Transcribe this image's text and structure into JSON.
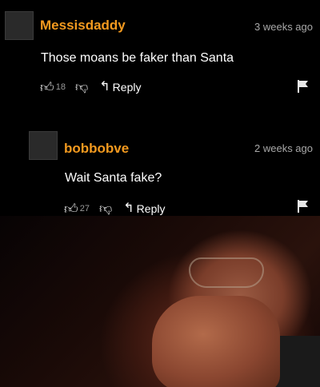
{
  "comments": [
    {
      "username": "Messisdaddy",
      "timestamp": "3 weeks ago",
      "text": "Those moans be faker than Santa",
      "upvotes": "18",
      "reply_label": "Reply"
    },
    {
      "username": "bobbobve",
      "timestamp": "2 weeks ago",
      "text": "Wait Santa fake?",
      "upvotes": "27",
      "reply_label": "Reply"
    }
  ],
  "colors": {
    "username": "#f39a1f",
    "background": "#000000",
    "timestamp": "#a8a8a8"
  },
  "icons": [
    "thumbs-up-icon",
    "thumbs-down-icon",
    "reply-arrow-icon",
    "flag-icon"
  ]
}
